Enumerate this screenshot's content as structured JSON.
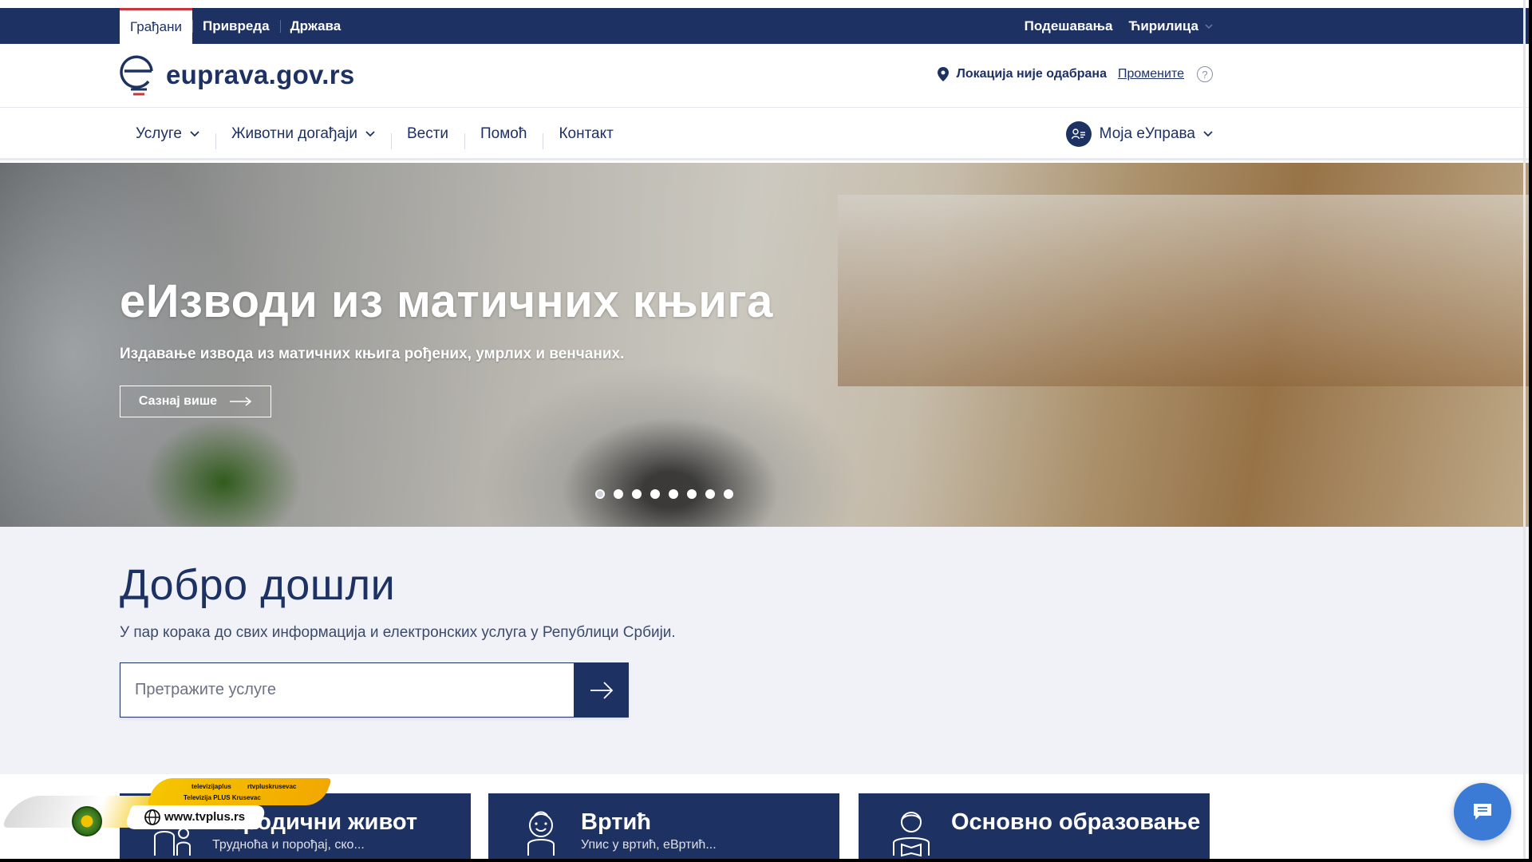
{
  "topbar": {
    "tabs": [
      "Грађани",
      "Привреда",
      "Држава"
    ],
    "active_tab": "Грађани",
    "settings_label": "Подешавања",
    "script_label": "Ћирилица"
  },
  "header": {
    "logo_text": "euprava.gov.rs",
    "location_text": "Локација није одабрана",
    "change_label": "Промените",
    "help_symbol": "?"
  },
  "nav": {
    "items": [
      {
        "label": "Услуге",
        "dropdown": true
      },
      {
        "label": "Животни догађаји",
        "dropdown": true
      },
      {
        "label": "Вести",
        "dropdown": false
      },
      {
        "label": "Помоћ",
        "dropdown": false
      },
      {
        "label": "Контакт",
        "dropdown": false
      }
    ],
    "account_label": "Моја еУправа"
  },
  "hero": {
    "title": "еИзводи из матичних књига",
    "subtitle": "Издавање извода из матичних књига рођених, умрлих и венчаних.",
    "button_label": "Сазнај више",
    "slide_count": 8,
    "active_slide": 0
  },
  "welcome": {
    "title": "Добро дошли",
    "subtitle": "У пар корака до свих информација и електронских услуга у Републици Србији.",
    "search_placeholder": "Претражите услуге"
  },
  "cards": [
    {
      "title": "Породични живот",
      "desc": "Трудноћа и порођај, ско...",
      "icon": "family-icon"
    },
    {
      "title": "Вртић",
      "desc": "Упис у вртић, еВртић...",
      "icon": "child-icon"
    },
    {
      "title": "Основно образовање",
      "desc": "",
      "icon": "student-icon"
    }
  ],
  "overlay": {
    "social1": "televizijaplus",
    "social2": "rtvpluskrusevac",
    "social3": "Televizija PLUS Krusevac",
    "url": "www.tvplus.rs"
  },
  "colors": {
    "brand": "#1d3163",
    "accent_red": "#c6363c",
    "chat_blue": "#3b7bd6",
    "welcome_bg": "#f0f2f8"
  }
}
